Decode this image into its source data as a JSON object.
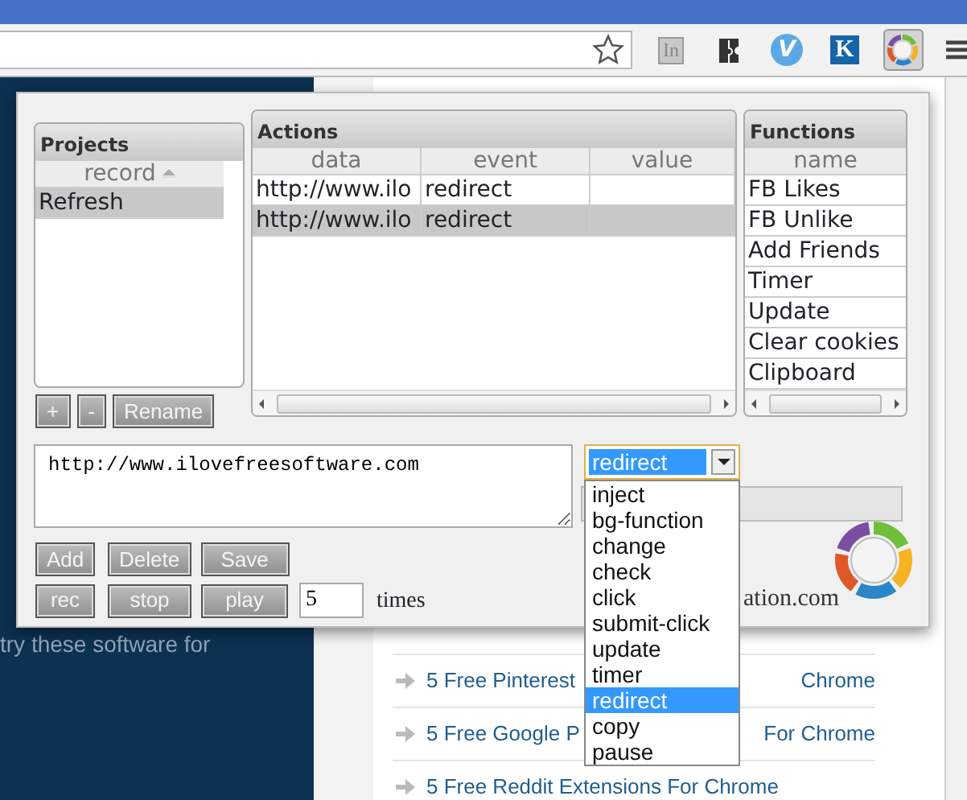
{
  "toolbar": {
    "extensions": [
      {
        "kind": "grey-badge",
        "label": "In",
        "active": false
      },
      {
        "kind": "dark-tile",
        "active": false
      },
      {
        "kind": "circle",
        "label": "V",
        "active": false
      },
      {
        "kind": "blue-badge",
        "label": "K",
        "active": false
      },
      {
        "kind": "cycle-logo",
        "active": true
      }
    ]
  },
  "page": {
    "side_text": "try these software for",
    "behind_text": "ation.com",
    "links": [
      {
        "parts": [
          "5 Free Pinterest",
          "Chrome"
        ]
      },
      {
        "parts": [
          "5 Free Google P",
          "For Chrome"
        ]
      },
      {
        "parts": [
          "5 Free Reddit Extensions For Chrome"
        ]
      }
    ]
  },
  "popup": {
    "projects": {
      "title": "Projects",
      "column": "record",
      "rows": [
        {
          "record": "Refresh",
          "selected": true
        }
      ],
      "buttons": [
        "+",
        "-",
        "Rename"
      ]
    },
    "actions": {
      "title": "Actions",
      "columns": [
        "data",
        "event",
        "value"
      ],
      "rows": [
        {
          "data": "http://www.ilo",
          "event": "redirect",
          "selected": false
        },
        {
          "data": "http://www.ilo",
          "event": "redirect",
          "selected": true
        }
      ]
    },
    "functions": {
      "title": "Functions",
      "column": "name",
      "rows": [
        "FB Likes",
        "FB Unlike",
        "Add Friends",
        "Timer",
        "Update",
        "Clear cookies",
        "Clipboard"
      ]
    },
    "editor": {
      "value": "http://www.ilovefreesoftware.com"
    },
    "event_select": {
      "value": "redirect",
      "open": true,
      "options": [
        {
          "label": "inject",
          "selected": false
        },
        {
          "label": "bg-function",
          "selected": false
        },
        {
          "label": "change",
          "selected": false
        },
        {
          "label": "check",
          "selected": false
        },
        {
          "label": "click",
          "selected": false
        },
        {
          "label": "submit-click",
          "selected": false
        },
        {
          "label": "update",
          "selected": false
        },
        {
          "label": "timer",
          "selected": false
        },
        {
          "label": "redirect",
          "selected": true
        },
        {
          "label": "copy",
          "selected": false
        },
        {
          "label": "pause",
          "selected": false
        }
      ]
    },
    "edit_buttons": [
      "Add",
      "Delete",
      "Save"
    ],
    "play_buttons": [
      "rec",
      "stop",
      "play"
    ],
    "repeat": {
      "value": "5",
      "unit": "times"
    }
  }
}
